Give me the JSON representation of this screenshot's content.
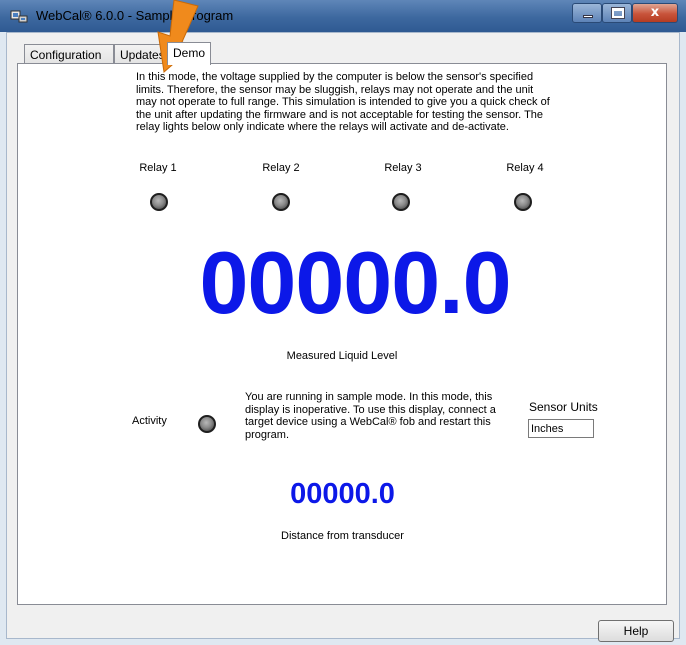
{
  "window": {
    "title": "WebCal® 6.0.0 - Sample Program",
    "close_glyph": "x"
  },
  "tabs": [
    {
      "label": "Configuration"
    },
    {
      "label": "Updates"
    },
    {
      "label": "Demo",
      "active": true
    }
  ],
  "demo": {
    "intro_text": "In this mode, the voltage supplied by the computer is below the sensor's specified limits. Therefore, the sensor may be sluggish, relays may not operate and the unit may not operate to full range. This simulation is intended to give you a quick check of the unit after updating the firmware and is not acceptable for testing the sensor. The relay lights below only indicate where the relays will activate and de-activate.",
    "relays": [
      {
        "label": "Relay 1"
      },
      {
        "label": "Relay 2"
      },
      {
        "label": "Relay 3"
      },
      {
        "label": "Relay 4"
      }
    ],
    "measured_value": "00000.0",
    "measured_caption": "Measured Liquid Level",
    "activity_label": "Activity",
    "sample_message": "You are running in sample mode. In this mode, this display is inoperative. To use this display, connect a target device using a WebCal® fob and restart this program.",
    "sensor_units_label": "Sensor Units",
    "sensor_units_value": "Inches",
    "distance_value": "00000.0",
    "distance_caption": "Distance from transducer"
  },
  "footer": {
    "help_label": "Help"
  },
  "colors": {
    "value_blue": "#0c18e8",
    "annotation_arrow": "#f08a1c",
    "titlebar": "#3d689f"
  },
  "icons": {
    "app": "app-icon",
    "annotation": "arrow-annotation-icon"
  }
}
